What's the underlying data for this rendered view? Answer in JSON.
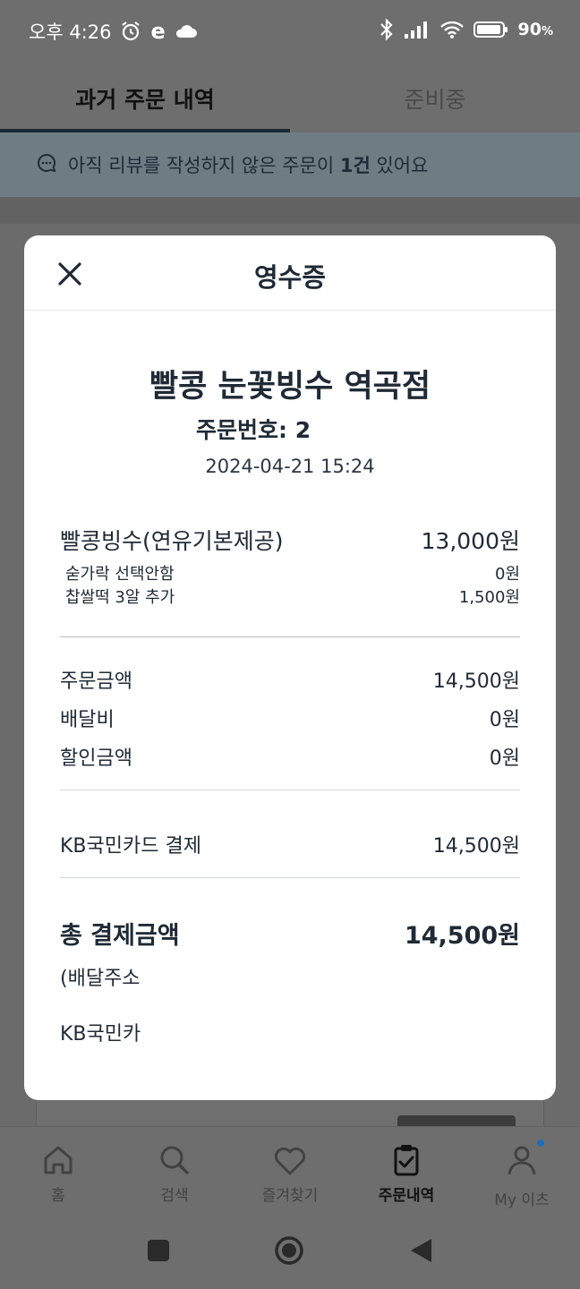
{
  "status_bar": {
    "time": "오후 4:26",
    "carrier_badge": "e",
    "battery": "90",
    "battery_unit": "%"
  },
  "tabs": [
    {
      "label": "과거 주문 내역",
      "active": true
    },
    {
      "label": "준비중",
      "active": false
    }
  ],
  "notice": {
    "prefix": "아직 리뷰를 작성하지 않은 주문이 ",
    "count": "1건",
    "suffix": " 있어요"
  },
  "receipt": {
    "title": "영수증",
    "store_name": "빨콩 눈꽃빙수 역곡점",
    "order_number_label": "주문번호: 2",
    "order_datetime": "2024-04-21 15:24",
    "item": {
      "name": "빨콩빙수(연유기본제공)",
      "price": "13,000원"
    },
    "options": [
      {
        "name": "숟가락 선택안함",
        "price": "0원"
      },
      {
        "name": "찹쌀떡 3알 추가",
        "price": "1,500원"
      }
    ],
    "summary": [
      {
        "label": "주문금액",
        "value": "14,500원"
      },
      {
        "label": "배달비",
        "value": "0원"
      },
      {
        "label": "할인금액",
        "value": "0원"
      }
    ],
    "payment": {
      "label": "KB국민카드 결제",
      "value": "14,500원"
    },
    "total": {
      "label": "총 결제금액",
      "value": "14,500원"
    },
    "address_partial": "(배달주소",
    "card_partial": "KB국민카"
  },
  "bottom_nav": [
    {
      "label": "홈",
      "icon": "home-icon"
    },
    {
      "label": "검색",
      "icon": "search-icon"
    },
    {
      "label": "즐겨찾기",
      "icon": "heart-icon"
    },
    {
      "label": "주문내역",
      "icon": "clipboard-check-icon",
      "active": true
    },
    {
      "label": "My 이츠",
      "icon": "user-icon"
    }
  ],
  "colors": {
    "overlay": "#6b6b6b",
    "text_dark": "#1f2a36",
    "notification_dot": "#1f6fb8"
  }
}
